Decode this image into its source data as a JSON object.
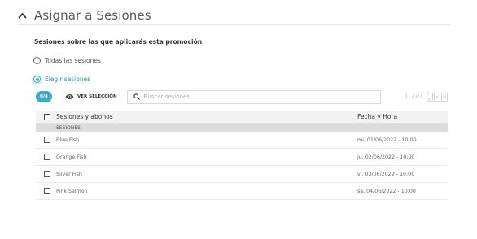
{
  "section": {
    "title": "Asignar a Sesiones",
    "caret_icon": "chevron-up-icon"
  },
  "subtitle": "Sesiones sobre las que aplicarás esta promoción",
  "options": [
    {
      "label": "Todas las sesiones",
      "selected": false
    },
    {
      "label": "Elegir sesiones",
      "selected": true
    }
  ],
  "toolbar": {
    "count": "0/4",
    "view_selection_label": "VER SELECCIÓN",
    "view_icon": "eye-icon",
    "search_icon": "search-icon",
    "search_placeholder": "Buscar sesiones",
    "pager_text": "1 – 4 of 4",
    "pager_first": "|<",
    "pager_prev": "<",
    "pager_next": ">"
  },
  "table": {
    "columns": [
      "Sesiones y abonos",
      "Fecha y Hora"
    ],
    "group_label": "SESIONES",
    "rows": [
      {
        "name": "Blue Fish",
        "date": "mi, 01/06/2022 - 10:00"
      },
      {
        "name": "Orange Fish",
        "date": "ju, 02/06/2022 - 10:00"
      },
      {
        "name": "Silver Fish",
        "date": "vi, 03/06/2022 - 10:00"
      },
      {
        "name": "Pink Salmon",
        "date": "sá, 04/06/2022 - 10:00"
      }
    ]
  },
  "colors": {
    "accent": "#3fa9c9",
    "header_bg": "#f2f2f2",
    "group_bg": "#dcdcdc"
  }
}
